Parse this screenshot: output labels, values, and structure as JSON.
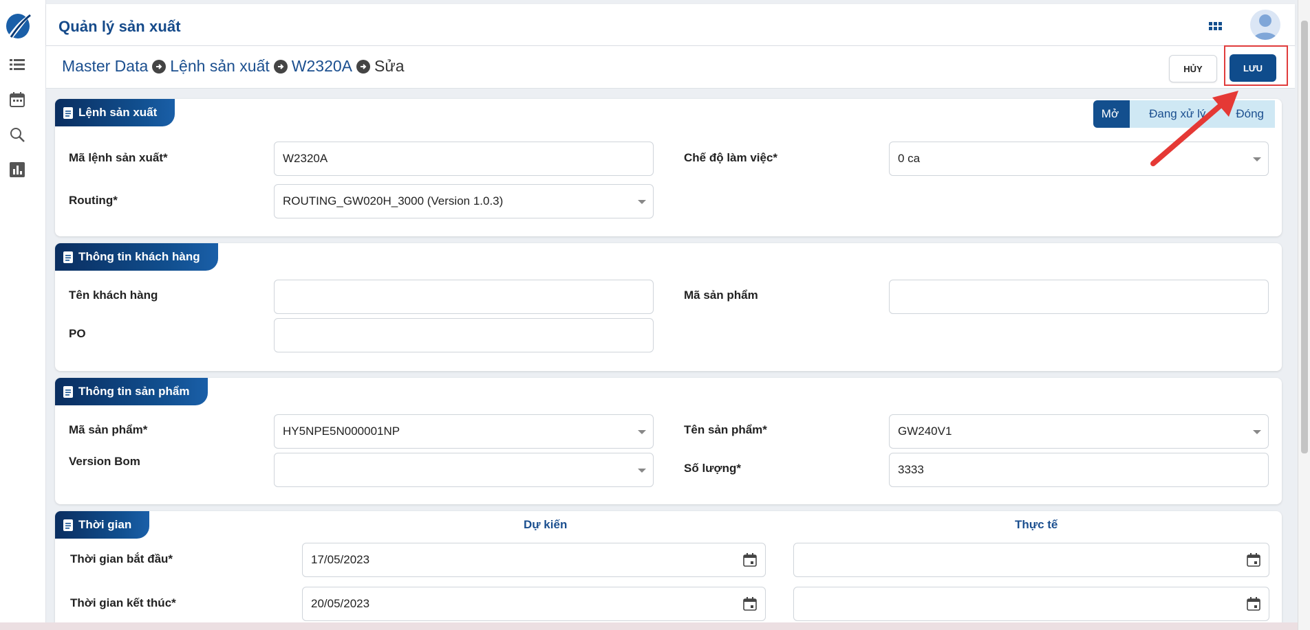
{
  "header": {
    "title": "Quản lý sản xuất"
  },
  "breadcrumb": {
    "items": [
      "Master Data",
      "Lệnh sản xuất",
      "W2320A",
      "Sửa"
    ]
  },
  "actions": {
    "cancel_label": "HỦY",
    "save_label": "LƯU"
  },
  "status_steps": [
    "Mở",
    "Đang xử lý",
    "Đóng"
  ],
  "sections": {
    "order": {
      "title": "Lệnh sản xuất",
      "order_code_label": "Mã lệnh sản xuất*",
      "order_code_value": "W2320A",
      "work_mode_label": "Chế độ làm việc*",
      "work_mode_value": "0 ca",
      "routing_label": "Routing*",
      "routing_value": "ROUTING_GW020H_3000 (Version 1.0.3)"
    },
    "customer": {
      "title": "Thông tin khách hàng",
      "customer_name_label": "Tên khách hàng",
      "customer_name_value": "",
      "product_code_label": "Mã sản phẩm",
      "product_code_value": "",
      "po_label": "PO",
      "po_value": ""
    },
    "product": {
      "title": "Thông tin sản phẩm",
      "product_code_label": "Mã sản phẩm*",
      "product_code_value": "HY5NPE5N000001NP",
      "product_name_label": "Tên sản phẩm*",
      "product_name_value": "GW240V1",
      "version_bom_label": "Version Bom",
      "version_bom_value": "",
      "quantity_label": "Số lượng*",
      "quantity_value": "3333"
    },
    "time": {
      "title": "Thời gian",
      "planned_header": "Dự kiến",
      "actual_header": "Thực tế",
      "start_label": "Thời gian bắt đầu*",
      "start_planned": "17/05/2023",
      "start_actual": "",
      "end_label": "Thời gian kết thúc*",
      "end_planned": "20/05/2023",
      "end_actual": ""
    }
  },
  "colors": {
    "brand": "#154a8a",
    "primary_button": "#0f4c8c",
    "highlight": "#e03b3b",
    "annotation_arrow": "#e53935"
  },
  "icons": [
    "logo-icon",
    "list-icon",
    "calendar-icon",
    "search-icon",
    "bar-chart-icon",
    "apps-grid-icon",
    "user-avatar-icon",
    "arrow-circle-right-icon",
    "document-icon",
    "chevron-down-icon"
  ]
}
